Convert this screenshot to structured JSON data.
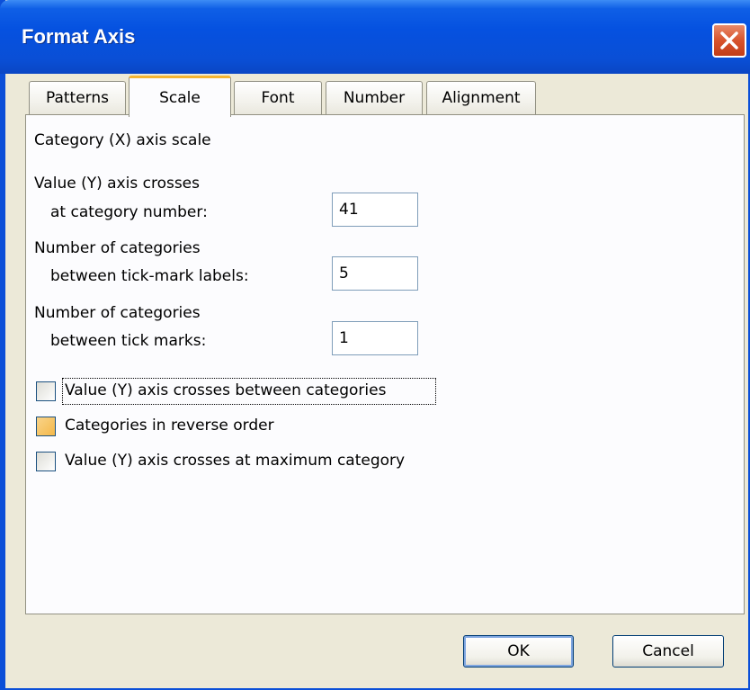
{
  "window": {
    "title": "Format Axis"
  },
  "tabs": [
    {
      "label": "Patterns"
    },
    {
      "label": "Scale"
    },
    {
      "label": "Font"
    },
    {
      "label": "Number"
    },
    {
      "label": "Alignment"
    }
  ],
  "active_tab": "Scale",
  "scale": {
    "section_title": "Category (X) axis scale",
    "crosses_line1": "Value (Y) axis crosses",
    "crosses_line2": "at category number:",
    "crosses_value": "41",
    "labels_line1": "Number of categories",
    "labels_line2": "between tick-mark labels:",
    "labels_value": "5",
    "marks_line1": "Number of categories",
    "marks_line2": "between tick marks:",
    "marks_value": "1"
  },
  "checkboxes": [
    {
      "label": "Value (Y) axis crosses between categories",
      "checked": false
    },
    {
      "label": "Categories in reverse order",
      "checked": false
    },
    {
      "label": "Value (Y) axis crosses at maximum category",
      "checked": false
    }
  ],
  "buttons": {
    "ok": "OK",
    "cancel": "Cancel"
  },
  "colors": {
    "titlebar": "#0551e0",
    "close": "#d8532c",
    "tab_highlight": "#f5b531"
  }
}
